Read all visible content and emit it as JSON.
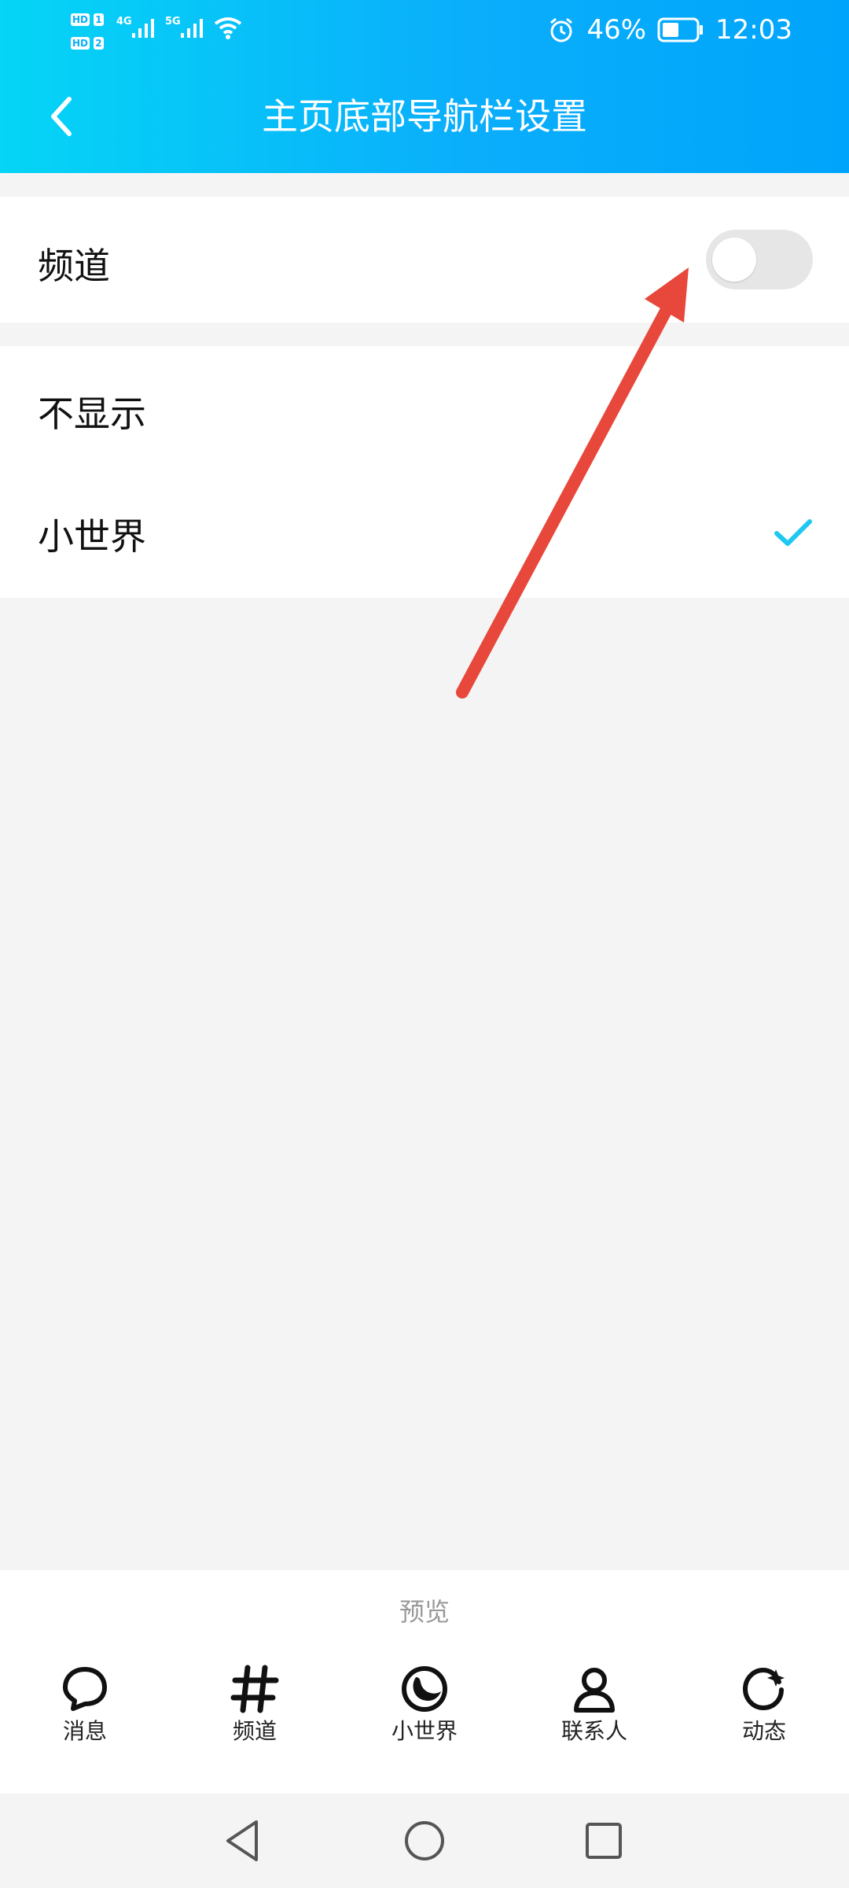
{
  "status_bar": {
    "sim1": "HD",
    "sim1_index": "1",
    "sim2": "HD",
    "sim2_index": "2",
    "network1": "4G",
    "network2": "5G",
    "battery_percent": "46%",
    "time": "12:03",
    "icons": [
      "alarm-icon",
      "battery-icon",
      "wifi-icon",
      "signal-icon"
    ]
  },
  "header": {
    "title": "主页底部导航栏设置",
    "back_icon": "chevron-left-icon"
  },
  "channel_row": {
    "label": "频道",
    "toggle_on": false
  },
  "options": [
    {
      "label": "不显示",
      "selected": false
    },
    {
      "label": "小世界",
      "selected": true
    }
  ],
  "preview": {
    "label": "预览",
    "nav_items": [
      {
        "label": "消息",
        "icon": "message-bubble-icon"
      },
      {
        "label": "频道",
        "icon": "hash-icon"
      },
      {
        "label": "小世界",
        "icon": "moon-circle-icon"
      },
      {
        "label": "联系人",
        "icon": "person-icon"
      },
      {
        "label": "动态",
        "icon": "refresh-star-icon"
      }
    ]
  },
  "system_nav": [
    "back-triangle-icon",
    "home-circle-icon",
    "recents-square-icon"
  ],
  "colors": {
    "header_gradient_start": "#05d5f6",
    "header_gradient_end": "#00a5fb",
    "checkmark": "#1ec8f0",
    "annotation_arrow": "#e8473b"
  }
}
